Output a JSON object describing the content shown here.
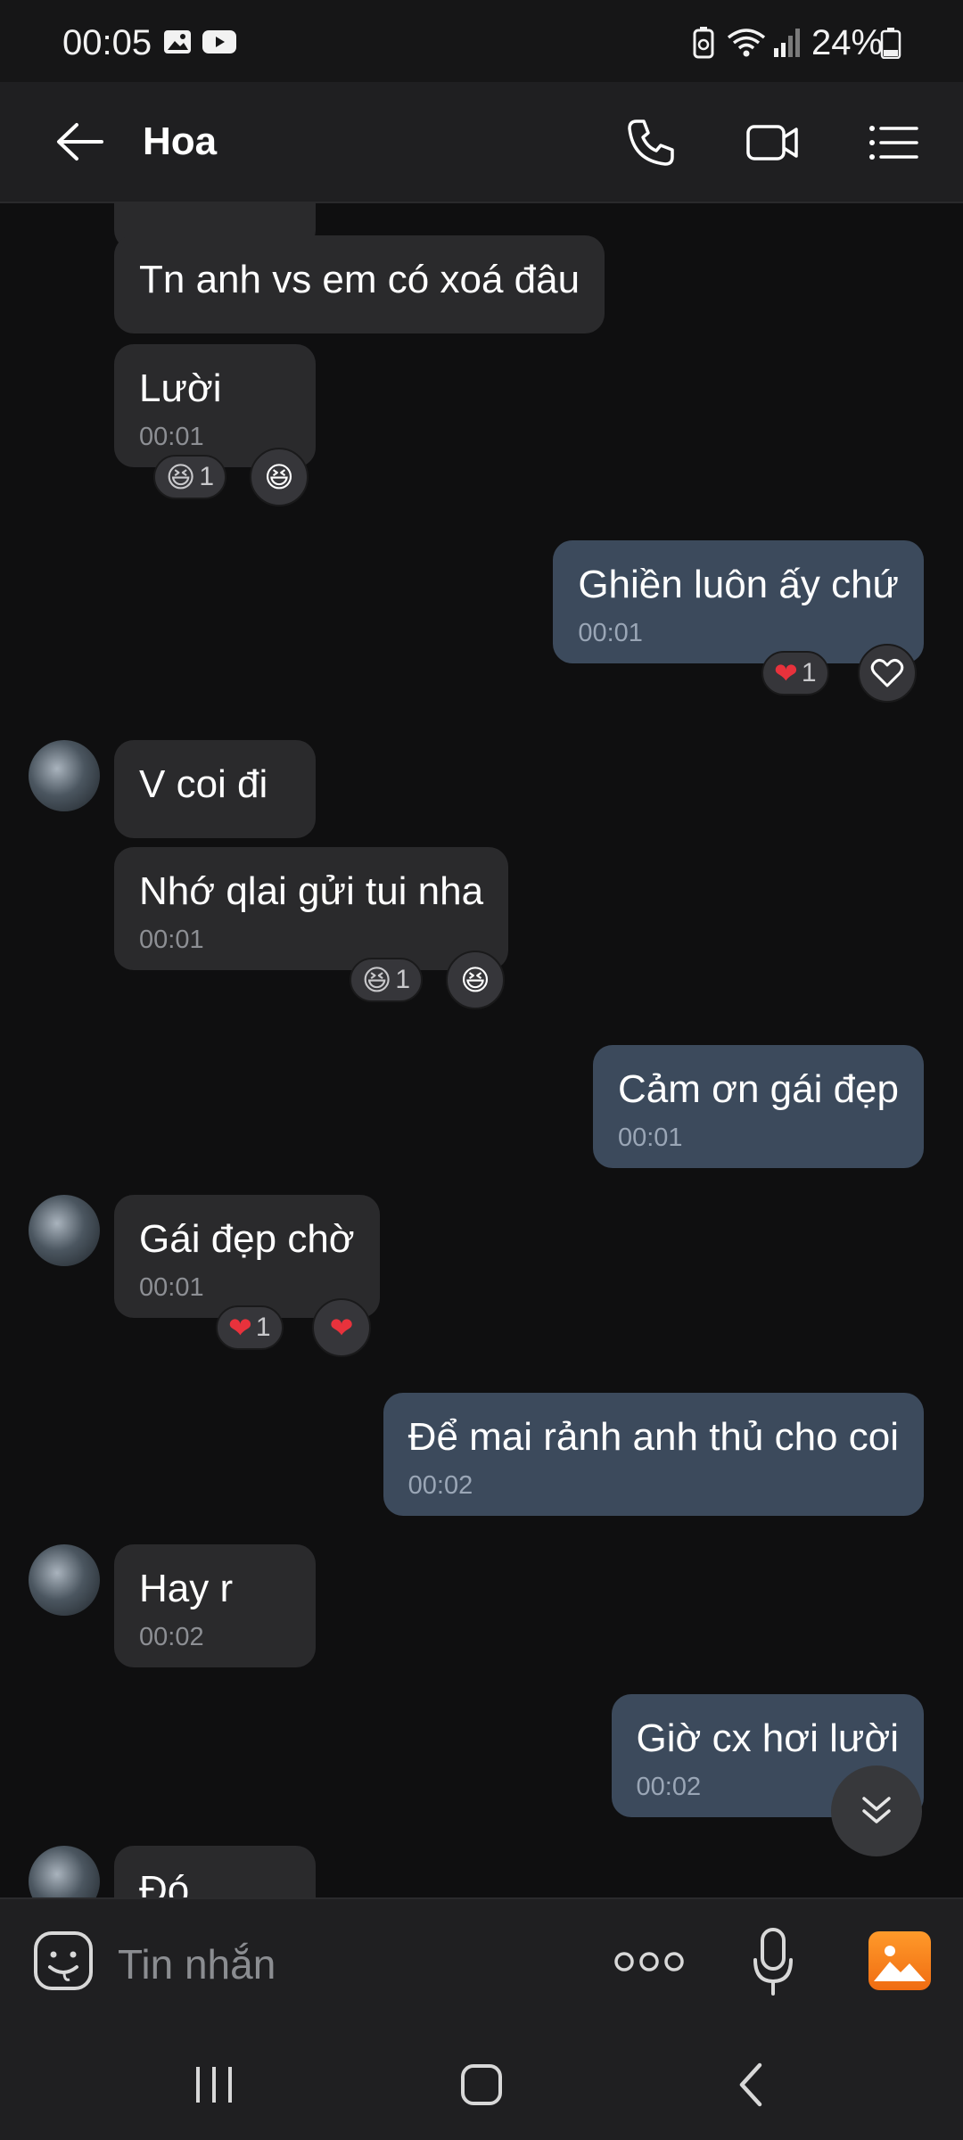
{
  "status_bar": {
    "time": "00:05",
    "battery_percent": "24%"
  },
  "header": {
    "contact_name": "Hoa"
  },
  "messages": [
    {
      "text": "Tn anh vs em có xoá đâu"
    },
    {
      "text": "Lười",
      "time": "00:01",
      "reaction_count": "1"
    },
    {
      "text": "Ghiền luôn ấy chứ",
      "time": "00:01",
      "reaction_count": "1"
    },
    {
      "text": "V coi đi"
    },
    {
      "text": "Nhớ qlai gửi tui nha",
      "time": "00:01",
      "reaction_count": "1"
    },
    {
      "text": "Cảm ơn gái đẹp",
      "time": "00:01"
    },
    {
      "text": "Gái đẹp chờ",
      "time": "00:01",
      "reaction_count": "1"
    },
    {
      "text": "Để mai rảnh anh thủ cho coi",
      "time": "00:02"
    },
    {
      "text": "Hay r",
      "time": "00:02"
    },
    {
      "text": "Giờ cx hơi lười",
      "time": "00:02"
    },
    {
      "text": "Đó"
    }
  ],
  "composer": {
    "placeholder": "Tin nhắn"
  },
  "colors": {
    "incoming": "#2a2a2c",
    "outgoing": "#3c4a5c",
    "background": "#0f0f10",
    "accent": "#f07a1a"
  },
  "icons": {
    "status": [
      "image-icon",
      "youtube-icon",
      "battery-saver-icon",
      "wifi-icon",
      "signal-icon",
      "battery-icon"
    ],
    "header": [
      "back-arrow-icon",
      "phone-icon",
      "video-icon",
      "menu-icon"
    ],
    "reactions": [
      "laughing-face-icon",
      "heart-icon"
    ],
    "composer": [
      "sticker-icon",
      "more-icon",
      "mic-icon",
      "gallery-icon"
    ],
    "navigation": [
      "recent-apps-icon",
      "home-icon",
      "back-icon"
    ]
  }
}
